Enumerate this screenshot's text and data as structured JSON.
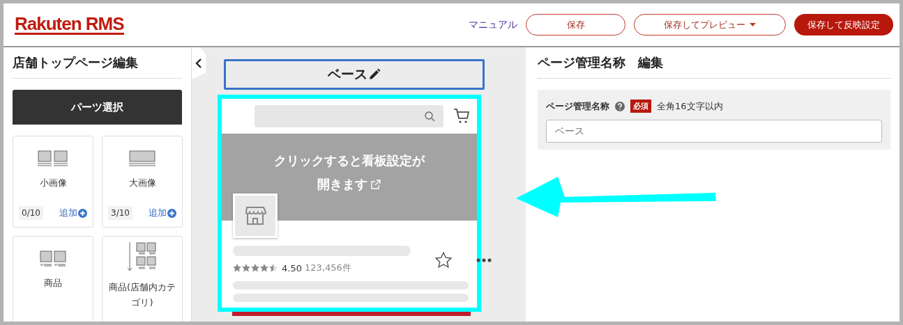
{
  "header": {
    "logo": "Rakuten RMS",
    "manual_link": "マニュアル",
    "buttons": [
      {
        "label": "保存",
        "kind": "outline"
      },
      {
        "label": "保存してプレビュー",
        "kind": "dropdown"
      },
      {
        "label": "保存して反映設定",
        "kind": "primary"
      }
    ]
  },
  "left_panel": {
    "title": "店舗トップページ編集",
    "parts_button": "パーツ選択",
    "parts": [
      {
        "label": "小画像",
        "kind": "small",
        "count": "0/10",
        "add": "追加"
      },
      {
        "label": "大画像",
        "kind": "large",
        "count": "3/10",
        "add": "追加"
      },
      {
        "label": "商品",
        "kind": "product"
      },
      {
        "label": "商品(店舗内カテゴリ)",
        "kind": "category"
      }
    ]
  },
  "preview": {
    "page_name": "ベース",
    "banner_lines": [
      "クリックすると看板設定が",
      "開きます"
    ],
    "stars": 4.5,
    "rating": "4.50",
    "review_count": "123,456件"
  },
  "right_panel": {
    "title": "ページ管理名称　編集",
    "field": {
      "label": "ページ管理名称",
      "required": "必須",
      "hint": "全角16文字以内",
      "value": "ベース"
    }
  }
}
